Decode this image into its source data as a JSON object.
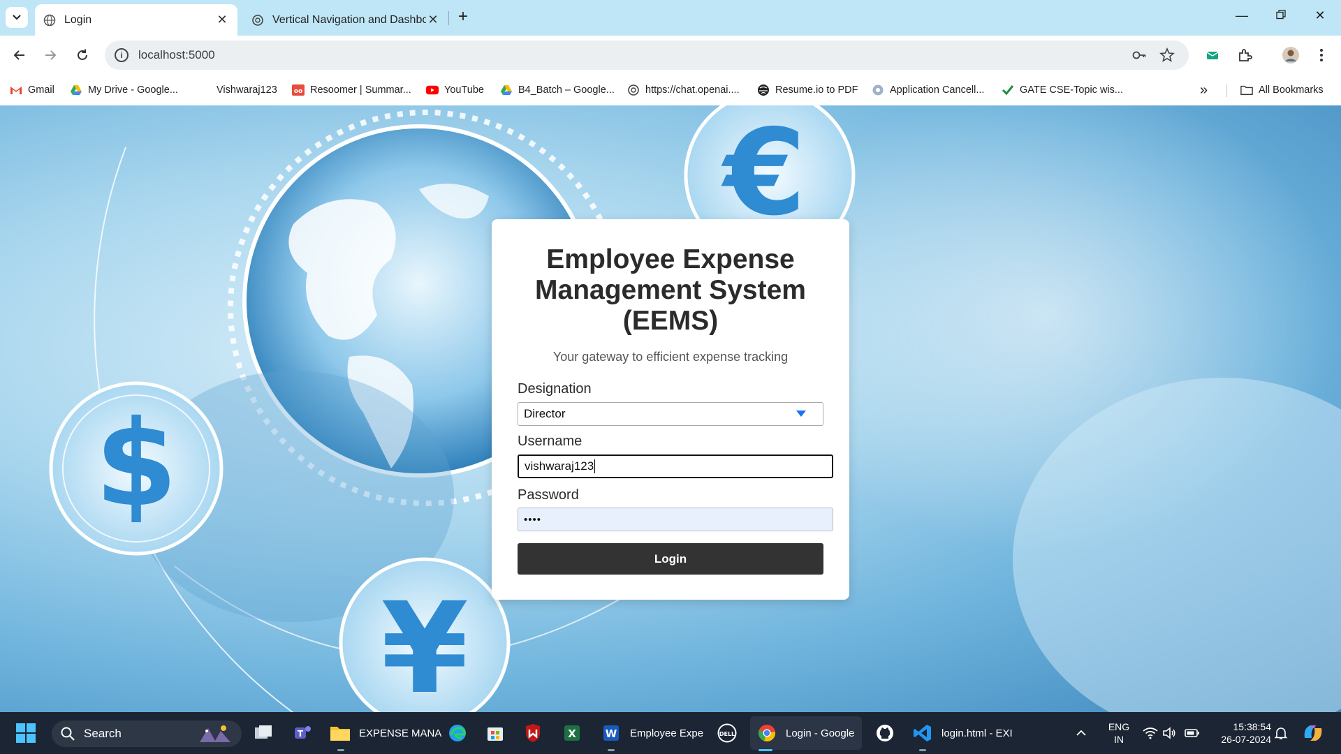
{
  "browser": {
    "tabs": [
      {
        "title": "Login",
        "active": true
      },
      {
        "title": "Vertical Navigation and Dashbo",
        "active": false
      }
    ],
    "url": "localhost:5000",
    "bookmarks": [
      {
        "label": "Gmail",
        "icon": "gmail-icon"
      },
      {
        "label": "My Drive - Google...",
        "icon": "drive-icon"
      },
      {
        "label": "Vishwaraj123",
        "icon": "none"
      },
      {
        "label": "Resoomer | Summar...",
        "icon": "resoomer-icon"
      },
      {
        "label": "YouTube",
        "icon": "youtube-icon"
      },
      {
        "label": "B4_Batch – Google...",
        "icon": "drive-icon"
      },
      {
        "label": "https://chat.openai....",
        "icon": "openai-icon"
      },
      {
        "label": "Resume.io to PDF",
        "icon": "globe-icon"
      },
      {
        "label": "Application Cancell...",
        "icon": "app-icon"
      },
      {
        "label": "GATE CSE-Topic wis...",
        "icon": "check-icon"
      }
    ],
    "all_bookmarks_label": "All Bookmarks"
  },
  "login": {
    "title": "Employee Expense Management System (EEMS)",
    "subtitle": "Your gateway to efficient expense tracking",
    "designation_label": "Designation",
    "designation_value": "Director",
    "username_label": "Username",
    "username_value": "vishwaraj123",
    "password_label": "Password",
    "password_value": "••••",
    "login_button": "Login"
  },
  "taskbar": {
    "search_label": "Search",
    "items": [
      {
        "label": "EXPENSE MANA",
        "icon": "folder-icon"
      },
      {
        "label": "Employee Expe",
        "icon": "word-icon"
      },
      {
        "label": "Login - Google",
        "icon": "chrome-icon"
      },
      {
        "label": "login.html - EXI",
        "icon": "vscode-icon"
      }
    ],
    "language": "ENG",
    "region": "IN",
    "time": "15:38:54",
    "date": "26-07-2024"
  },
  "colors": {
    "tabstrip": "#bfe6f6",
    "login_button": "#333333",
    "taskbar": "#1c2533",
    "select_caret": "#1a73e8"
  }
}
